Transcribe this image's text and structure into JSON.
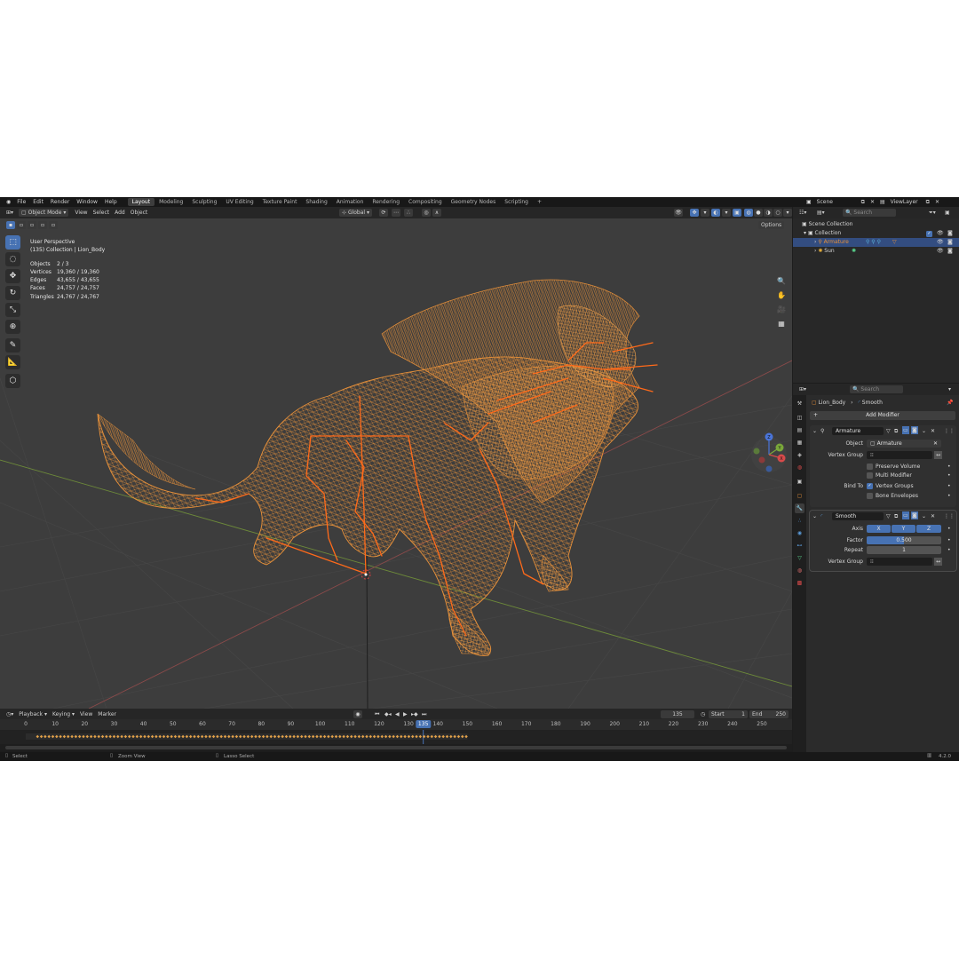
{
  "menubar": {
    "menus": [
      "File",
      "Edit",
      "Render",
      "Window",
      "Help"
    ],
    "workspaces": [
      {
        "label": "Layout",
        "active": true
      },
      {
        "label": "Modeling"
      },
      {
        "label": "Sculpting"
      },
      {
        "label": "UV Editing"
      },
      {
        "label": "Texture Paint"
      },
      {
        "label": "Shading"
      },
      {
        "label": "Animation"
      },
      {
        "label": "Rendering"
      },
      {
        "label": "Compositing"
      },
      {
        "label": "Geometry Nodes"
      },
      {
        "label": "Scripting"
      }
    ],
    "add_tab": "+",
    "scene_name": "Scene",
    "view_layer": "ViewLayer"
  },
  "viewport_header": {
    "mode": "Object Mode",
    "menus": [
      "View",
      "Select",
      "Add",
      "Object"
    ],
    "orientation": "Global",
    "options": "Options"
  },
  "viewport": {
    "view_name": "User Perspective",
    "collection_line": "(135) Collection | Lion_Body",
    "stats": [
      {
        "label": "Objects",
        "value": "2 / 3"
      },
      {
        "label": "Vertices",
        "value": "19,360 / 19,360"
      },
      {
        "label": "Edges",
        "value": "43,655 / 43,655"
      },
      {
        "label": "Faces",
        "value": "24,757 / 24,757"
      },
      {
        "label": "Triangles",
        "value": "24,767 / 24,767"
      }
    ],
    "mesh_color": "#e8913a",
    "bone_color": "#ff6a1a",
    "gizmo_labels": {
      "z": "Z",
      "y": "Y",
      "x": "X"
    }
  },
  "outliner": {
    "search_placeholder": "Search",
    "root": "Scene Collection",
    "collection": "Collection",
    "items": [
      {
        "name": "Armature",
        "selected": true
      },
      {
        "name": "Sun",
        "selected": false
      }
    ]
  },
  "properties": {
    "search_placeholder": "Search",
    "breadcrumb_object": "Lion_Body",
    "breadcrumb_modifier": "Smooth",
    "add_modifier": "Add Modifier",
    "armature_mod": {
      "name": "Armature",
      "object_label": "Object",
      "object_value": "Armature",
      "vertex_group_label": "Vertex Group",
      "preserve_volume": "Preserve Volume",
      "multi_modifier": "Multi Modifier",
      "bind_to_label": "Bind To",
      "vertex_groups": "Vertex Groups",
      "bone_envelopes": "Bone Envelopes"
    },
    "smooth_mod": {
      "name": "Smooth",
      "axis_label": "Axis",
      "axis_x": "X",
      "axis_y": "Y",
      "axis_z": "Z",
      "factor_label": "Factor",
      "factor_value": "0.500",
      "repeat_label": "Repeat",
      "repeat_value": "1",
      "vertex_group_label": "Vertex Group"
    }
  },
  "timeline": {
    "menus": [
      "Playback",
      "Keying",
      "View",
      "Marker"
    ],
    "current_frame": "135",
    "start_label": "Start",
    "start_value": "1",
    "end_label": "End",
    "end_value": "250",
    "ticks": [
      "0",
      "10",
      "20",
      "30",
      "40",
      "50",
      "60",
      "70",
      "80",
      "90",
      "100",
      "110",
      "120",
      "130",
      "140",
      "150",
      "160",
      "170",
      "180",
      "190",
      "200",
      "210",
      "220",
      "230",
      "240",
      "250"
    ],
    "keyframe_color": "#e3a24a",
    "playhead_color": "#4772b3"
  },
  "statusbar": {
    "select": "Select",
    "zoom_view": "Zoom View",
    "lasso_select": "Lasso Select",
    "version": "4.2.0"
  }
}
